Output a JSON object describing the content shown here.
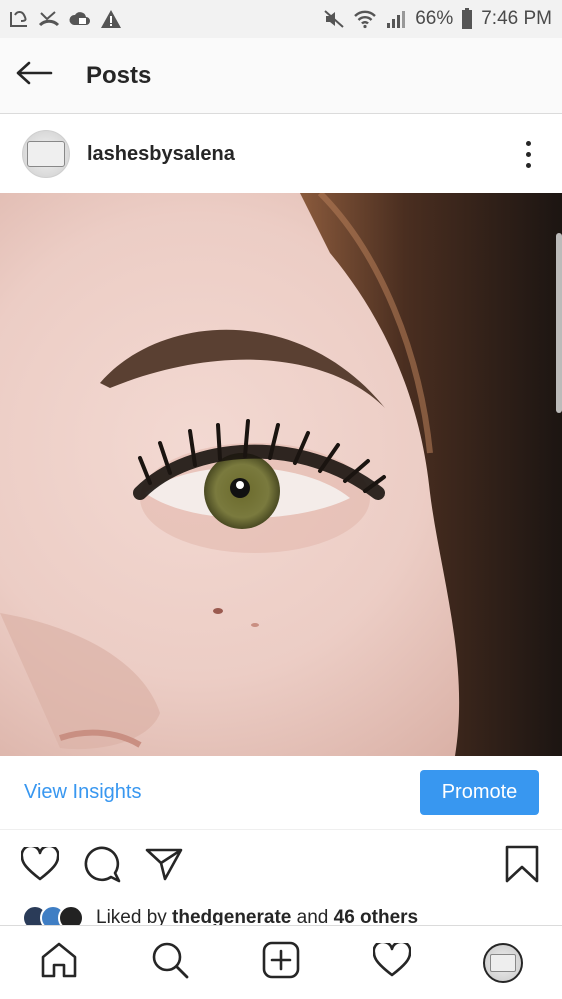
{
  "status_bar": {
    "battery": "66%",
    "time": "7:46 PM",
    "left_icons": [
      "notification-icon",
      "missed-call-icon",
      "cloud-icon",
      "warning-icon"
    ],
    "right_icons": [
      "mute-icon",
      "wifi-icon",
      "signal-icon",
      "battery-icon"
    ]
  },
  "header": {
    "title": "Posts",
    "back_icon": "arrow-left-icon"
  },
  "post": {
    "username": "lashesbysalena",
    "more_icon": "more-vertical-icon",
    "image": "close-up eye with lash extensions"
  },
  "insights": {
    "view_label": "View Insights",
    "promote_label": "Promote",
    "accent": "#3897f0"
  },
  "actions": [
    "heart-icon",
    "comment-icon",
    "share-icon",
    "bookmark-icon"
  ],
  "likes": {
    "prefix": "Liked by ",
    "user": "thedgenerate",
    "middle": " and ",
    "others": "46 others"
  },
  "bottom_nav": [
    "home-icon",
    "search-icon",
    "add-post-icon",
    "activity-heart-icon",
    "profile-avatar"
  ]
}
